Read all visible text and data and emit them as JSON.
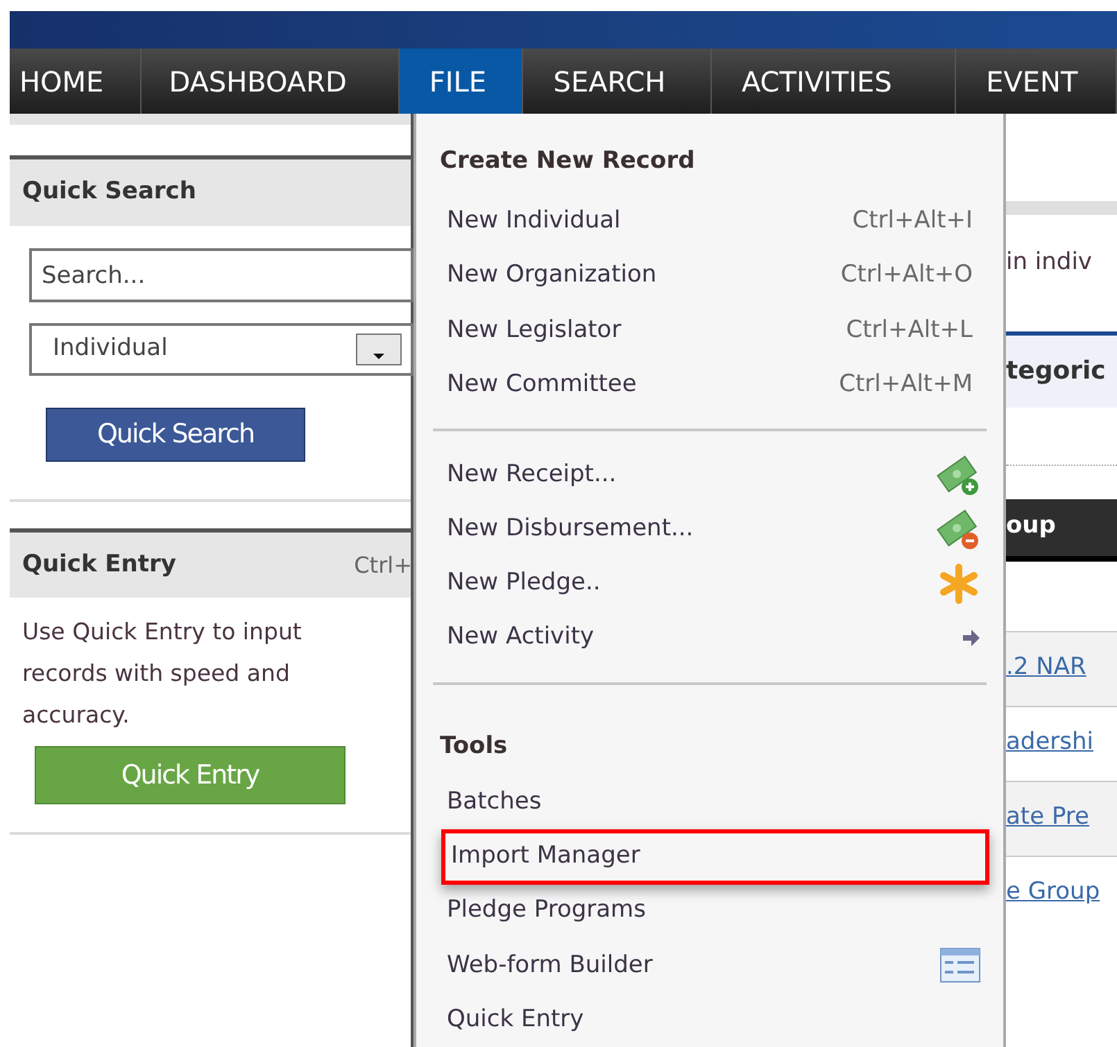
{
  "nav": [
    {
      "label": "HOME",
      "selected": false
    },
    {
      "label": "DASHBOARD",
      "selected": false
    },
    {
      "label": "FILE",
      "selected": true
    },
    {
      "label": "SEARCH",
      "selected": false
    },
    {
      "label": "ACTIVITIES",
      "selected": false
    },
    {
      "label": "EVENT",
      "selected": false
    }
  ],
  "quick_search": {
    "title": "Quick Search",
    "search": {
      "placeholder": "Search..."
    },
    "type_select": {
      "value": "Individual"
    },
    "button": "Quick Search"
  },
  "quick_entry": {
    "title": "Quick Entry",
    "shortcut": "Ctrl+",
    "description": "Use Quick Entry to input records with speed and accuracy.",
    "button": "Quick Entry"
  },
  "file_menu": [
    {
      "kind": "header",
      "label": "Create New Record"
    },
    {
      "kind": "shortcut",
      "label": "New Individual",
      "shortcut": "Ctrl+Alt+I"
    },
    {
      "kind": "shortcut",
      "label": "New Organization",
      "shortcut": "Ctrl+Alt+O"
    },
    {
      "kind": "shortcut",
      "label": "New Legislator",
      "shortcut": "Ctrl+Alt+L"
    },
    {
      "kind": "shortcut",
      "label": "New Committee",
      "shortcut": "Ctrl+Alt+M"
    },
    {
      "kind": "separator"
    },
    {
      "kind": "receipt",
      "label": "New Receipt..."
    },
    {
      "kind": "disbursement",
      "label": "New Disbursement..."
    },
    {
      "kind": "pledge",
      "label": "New Pledge.."
    },
    {
      "kind": "submenu",
      "label": "New Activity"
    },
    {
      "kind": "separator"
    },
    {
      "kind": "header",
      "label": "Tools"
    },
    {
      "kind": "plain",
      "label": "Batches",
      "highlighted": false
    },
    {
      "kind": "plain",
      "label": "Import Manager",
      "highlighted": true
    },
    {
      "kind": "plain",
      "label": "Pledge Programs",
      "highlighted": false
    },
    {
      "kind": "form",
      "label": "Web-form Builder"
    },
    {
      "kind": "plain",
      "label": "Quick Entry",
      "highlighted": false
    }
  ],
  "background_content": {
    "intro_text": "in indiv",
    "section_heading": "tegoric",
    "table_header": "oup",
    "links": [
      ".2 NAR",
      "adershi",
      "ate Pre",
      "e Group"
    ]
  }
}
